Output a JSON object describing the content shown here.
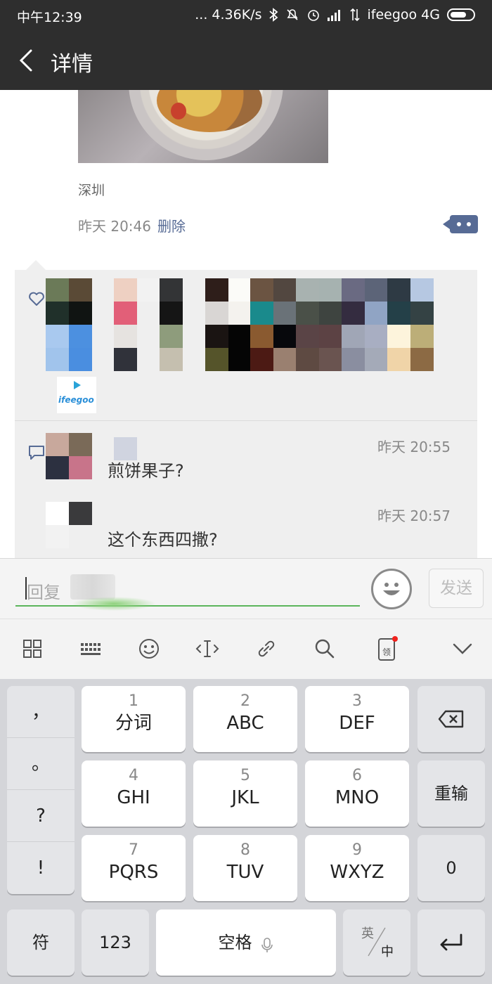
{
  "status_bar": {
    "time": "中午12:39",
    "network_speed": "... 4.36K/s",
    "carrier": "ifeegoo 4G"
  },
  "nav": {
    "title": "详情"
  },
  "post": {
    "location": "深圳",
    "time": "昨天 20:46",
    "delete_label": "删除"
  },
  "likes": {
    "logo_text": "ifeegoo"
  },
  "comments": [
    {
      "time": "昨天 20:55",
      "text": "煎饼果子?"
    },
    {
      "time": "昨天 20:57",
      "text": "这个东西四撒?"
    }
  ],
  "reply": {
    "placeholder": "回复",
    "send_label": "发送"
  },
  "keyboard": {
    "punctuation": [
      "，",
      "。",
      "?",
      "!"
    ],
    "keys": [
      {
        "num": "1",
        "label": "分词"
      },
      {
        "num": "2",
        "label": "ABC"
      },
      {
        "num": "3",
        "label": "DEF"
      },
      {
        "num": "4",
        "label": "GHI"
      },
      {
        "num": "5",
        "label": "JKL"
      },
      {
        "num": "6",
        "label": "MNO"
      },
      {
        "num": "7",
        "label": "PQRS"
      },
      {
        "num": "8",
        "label": "TUV"
      },
      {
        "num": "9",
        "label": "WXYZ"
      }
    ],
    "reenter_label": "重输",
    "zero_label": "0",
    "symbol_label": "符",
    "num_label": "123",
    "space_label": "空格",
    "lang_en": "英",
    "lang_zh": "中"
  },
  "colors": {
    "bar_bg": "#2e2e2e",
    "link": "#576b95",
    "accent_green": "#5bb55b",
    "badge_red": "#f0221d"
  }
}
